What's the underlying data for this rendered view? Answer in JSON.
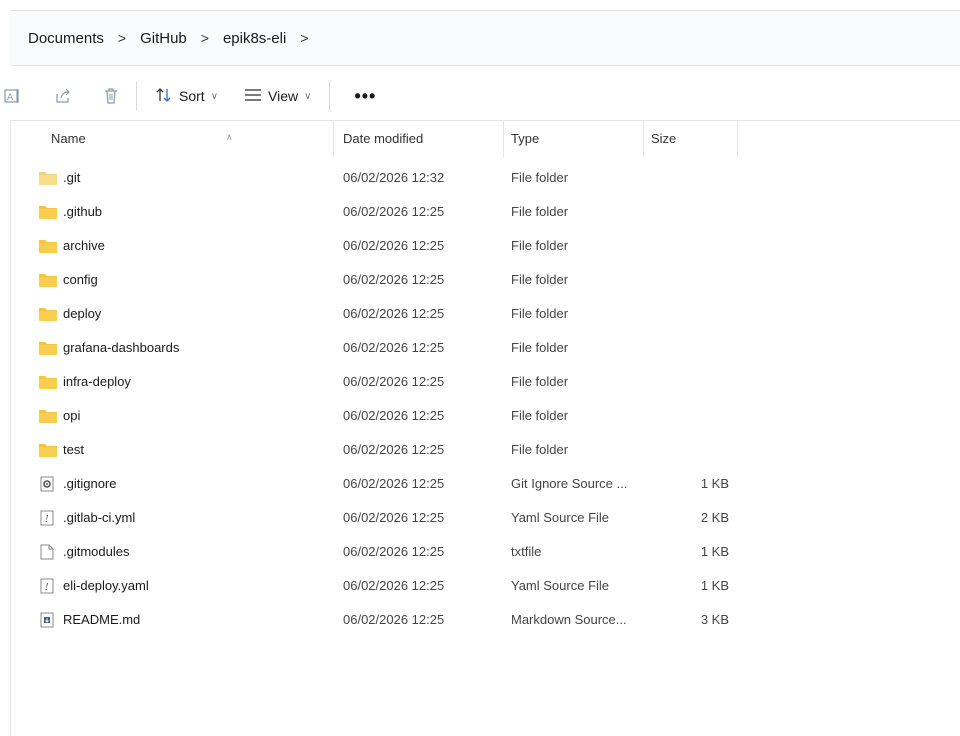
{
  "breadcrumb": {
    "items": [
      "Documents",
      "GitHub",
      "epik8s-eli"
    ],
    "separator": ">"
  },
  "toolbar": {
    "sort_label": "Sort",
    "view_label": "View",
    "more_label": "•••"
  },
  "columns": {
    "name": "Name",
    "date": "Date modified",
    "type": "Type",
    "size": "Size"
  },
  "files": [
    {
      "name": ".git",
      "date": "06/02/2026 12:32",
      "type": "File folder",
      "size": "",
      "icon": "folder-light-icon"
    },
    {
      "name": ".github",
      "date": "06/02/2026 12:25",
      "type": "File folder",
      "size": "",
      "icon": "folder-icon"
    },
    {
      "name": "archive",
      "date": "06/02/2026 12:25",
      "type": "File folder",
      "size": "",
      "icon": "folder-icon"
    },
    {
      "name": "config",
      "date": "06/02/2026 12:25",
      "type": "File folder",
      "size": "",
      "icon": "folder-icon"
    },
    {
      "name": "deploy",
      "date": "06/02/2026 12:25",
      "type": "File folder",
      "size": "",
      "icon": "folder-icon"
    },
    {
      "name": "grafana-dashboards",
      "date": "06/02/2026 12:25",
      "type": "File folder",
      "size": "",
      "icon": "folder-icon"
    },
    {
      "name": "infra-deploy",
      "date": "06/02/2026 12:25",
      "type": "File folder",
      "size": "",
      "icon": "folder-icon"
    },
    {
      "name": "opi",
      "date": "06/02/2026 12:25",
      "type": "File folder",
      "size": "",
      "icon": "folder-icon"
    },
    {
      "name": "test",
      "date": "06/02/2026 12:25",
      "type": "File folder",
      "size": "",
      "icon": "folder-icon"
    },
    {
      "name": ".gitignore",
      "date": "06/02/2026 12:25",
      "type": "Git Ignore Source ...",
      "size": "1 KB",
      "icon": "gear-file-icon"
    },
    {
      "name": ".gitlab-ci.yml",
      "date": "06/02/2026 12:25",
      "type": "Yaml Source File",
      "size": "2 KB",
      "icon": "yaml-file-icon"
    },
    {
      "name": ".gitmodules",
      "date": "06/02/2026 12:25",
      "type": "txtfile",
      "size": "1 KB",
      "icon": "blank-file-icon"
    },
    {
      "name": "eli-deploy.yaml",
      "date": "06/02/2026 12:25",
      "type": "Yaml Source File",
      "size": "1 KB",
      "icon": "yaml-file-icon"
    },
    {
      "name": "README.md",
      "date": "06/02/2026 12:25",
      "type": "Markdown Source...",
      "size": "3 KB",
      "icon": "markdown-file-icon"
    }
  ],
  "colors": {
    "folder": "#f5c342",
    "folder_light": "#f7dc8c",
    "address_bg": "#f9fbfd"
  }
}
